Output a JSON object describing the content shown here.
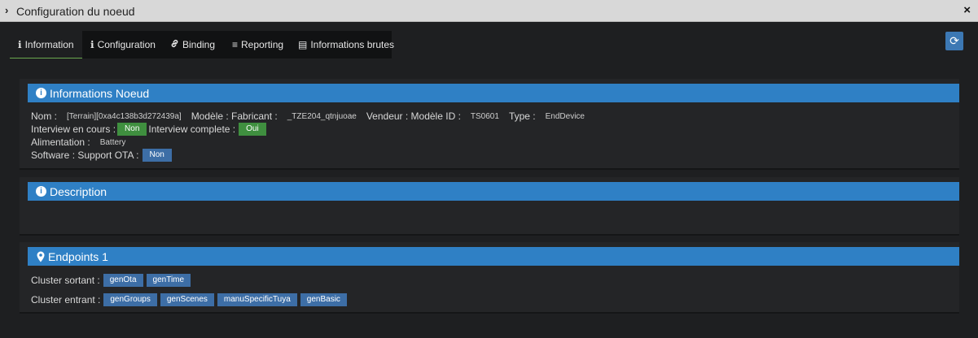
{
  "window": {
    "title": "Configuration du noeud",
    "chevron_glyph": "›",
    "close_glyph": "×"
  },
  "tabs": [
    {
      "label": "Information",
      "icon": "info-icon",
      "glyph": "ℹ",
      "active": true
    },
    {
      "label": "Configuration",
      "icon": "info-icon",
      "glyph": "ℹ",
      "active": false
    },
    {
      "label": "Binding",
      "icon": "link-icon",
      "glyph": "🔗",
      "active": false
    },
    {
      "label": "Reporting",
      "icon": "bars-icon",
      "glyph": "≡",
      "active": false
    },
    {
      "label": "Informations brutes",
      "icon": "list-icon",
      "glyph": "▤",
      "active": false
    }
  ],
  "refresh": {
    "icon": "refresh-icon",
    "glyph": "⟳"
  },
  "info_panel": {
    "title": "Informations Noeud",
    "nom_label": "Nom :",
    "nom_value": "[Terrain][0xa4c138b3d272439a]",
    "modele_fabricant_label": "Modèle : Fabricant :",
    "modele_fabricant_value": "_TZE204_qtnjuoae",
    "vendeur_label": "Vendeur : Modèle ID :",
    "vendeur_value": "TS0601",
    "type_label": "Type :",
    "type_value": "EndDevice",
    "interview_cours_label": "Interview en cours :",
    "interview_cours_value": "Non",
    "interview_complete_label": "Interview complete :",
    "interview_complete_value": "Oui",
    "alimentation_label": "Alimentation :",
    "alimentation_value": "Battery",
    "software_label": "Software : Support OTA :",
    "software_value": "Non"
  },
  "description_panel": {
    "title": "Description"
  },
  "endpoints_panel": {
    "title": "Endpoints 1",
    "cluster_sortant_label": "Cluster sortant :",
    "cluster_sortant": [
      "genOta",
      "genTime"
    ],
    "cluster_entrant_label": "Cluster entrant :",
    "cluster_entrant": [
      "genGroups",
      "genScenes",
      "manuSpecificTuya",
      "genBasic"
    ]
  },
  "colors": {
    "header_blue": "#2f80c5",
    "badge_green": "#3f8f3f",
    "badge_blue": "#3d6ea6",
    "tab_active_underline": "#6aa84f"
  }
}
